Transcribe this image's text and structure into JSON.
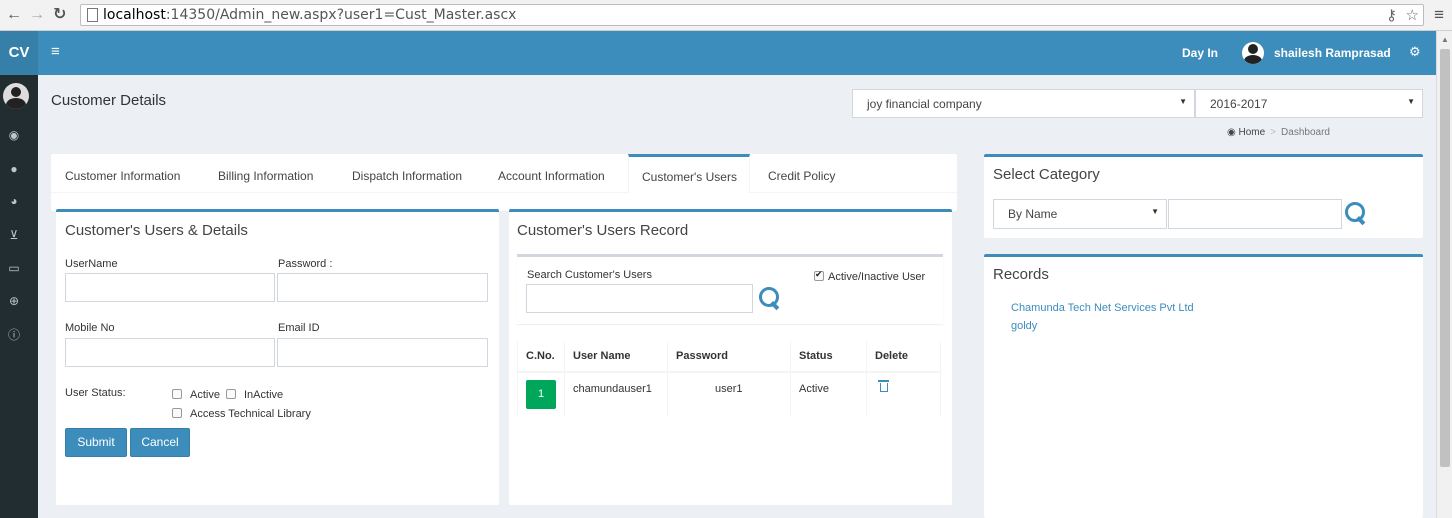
{
  "browser": {
    "back_icon": "back-arrow-icon",
    "forward_icon": "forward-arrow-icon",
    "reload_icon": "reload-icon",
    "url_host": "localhost",
    "url_rest": ":14350/Admin_new.aspx?user1=Cust_Master.ascx"
  },
  "sidebar": {
    "logo": "CV",
    "icons": [
      "dashboard-icon",
      "user-icon",
      "pie-chart-icon",
      "cart-icon",
      "credit-card-icon",
      "globe-icon",
      "info-icon"
    ]
  },
  "header": {
    "day_in": "Day In",
    "user_name": "shailesh Ramprasad"
  },
  "page": {
    "title": "Customer Details",
    "company": "joy financial company",
    "year": "2016-2017",
    "breadcrumb": {
      "home": "Home",
      "current": "Dashboard"
    }
  },
  "tabs": [
    {
      "label": "Customer Information",
      "active": false
    },
    {
      "label": "Billing Information",
      "active": false
    },
    {
      "label": "Dispatch Information",
      "active": false
    },
    {
      "label": "Account Information",
      "active": false
    },
    {
      "label": "Customer's Users",
      "active": true
    },
    {
      "label": "Credit Policy",
      "active": false
    }
  ],
  "details_form": {
    "title": "Customer's Users & Details",
    "username_label": "UserName",
    "password_label": "Password :",
    "username_value": "",
    "password_value": "",
    "mobile_label": "Mobile No",
    "email_label": "Email ID",
    "mobile_value": "",
    "email_value": "",
    "status_label": "User Status:",
    "active_label": "Active",
    "inactive_label": "InActive",
    "library_label": "Access Technical Library",
    "active_checked": false,
    "inactive_checked": false,
    "library_checked": false,
    "submit": "Submit",
    "cancel": "Cancel"
  },
  "records_panel": {
    "title": "Customer's Users Record",
    "search_label": "Search Customer's Users",
    "search_value": "",
    "active_inactive_label": "Active/Inactive User",
    "active_inactive_checked": true,
    "columns": [
      "C.No.",
      "User Name",
      "Password",
      "Status",
      "Delete"
    ],
    "rows": [
      {
        "cno": "1",
        "user": "chamundauser1",
        "password": "user1",
        "status": "Active"
      }
    ]
  },
  "category": {
    "title": "Select Category",
    "by": "By Name",
    "search_value": ""
  },
  "records": {
    "title": "Records",
    "items": [
      "Chamunda Tech Net Services Pvt Ltd",
      "goldy"
    ]
  }
}
